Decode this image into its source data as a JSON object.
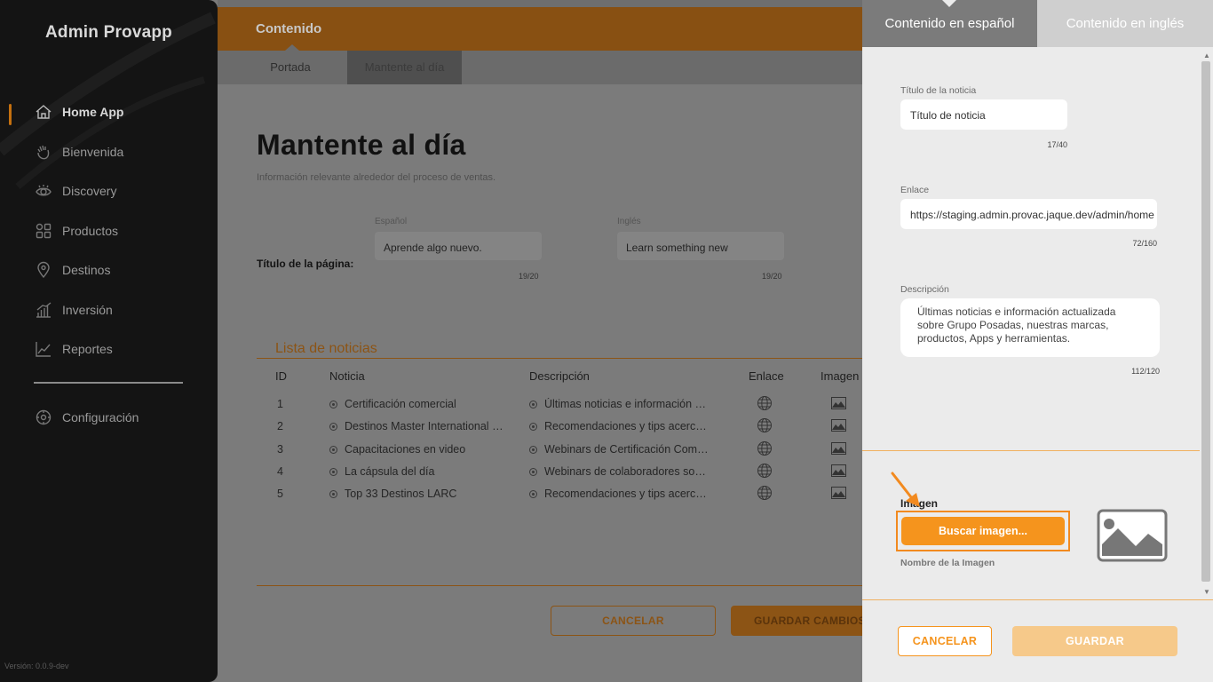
{
  "sidebar": {
    "brand": "Admin Provapp",
    "items": [
      {
        "label": "Home App",
        "icon": "home-icon",
        "active": true
      },
      {
        "label": "Bienvenida",
        "icon": "wave-hand-icon"
      },
      {
        "label": "Discovery",
        "icon": "eye-icon"
      },
      {
        "label": "Productos",
        "icon": "grid-icon"
      },
      {
        "label": "Destinos",
        "icon": "location-pin-icon"
      },
      {
        "label": "Inversión",
        "icon": "bar-chart-icon"
      },
      {
        "label": "Reportes",
        "icon": "line-chart-icon"
      }
    ],
    "settings": {
      "label": "Configuración",
      "icon": "gear-icon"
    },
    "version": "Versión: 0.0.9-dev"
  },
  "main": {
    "header_title": "Contenido",
    "tabs": [
      "Portada",
      "Mantente al día"
    ],
    "page_title": "Mantente al día",
    "page_desc": "Información relevante alrededor del proceso de ventas.",
    "field_label": "Título de la página:",
    "es_label": "Español",
    "es_value": "Aprende algo nuevo.",
    "es_count": "19/20",
    "en_label": "Inglés",
    "en_value": "Learn something new",
    "en_count": "19/20",
    "list_title": "Lista de noticias",
    "columns": [
      "ID",
      "Noticia",
      "Descripción",
      "Enlace",
      "Imagen"
    ],
    "rows": [
      {
        "id": "1",
        "noticia": "Certificación comercial",
        "descripcion": "Últimas noticias e información actualizada"
      },
      {
        "id": "2",
        "noticia": "Destinos Master International Certification",
        "descripcion": "Recomendaciones y tips acerca de destinos"
      },
      {
        "id": "3",
        "noticia": "Capacitaciones en video",
        "descripcion": "Webinars de Certificación Comercial"
      },
      {
        "id": "4",
        "noticia": "La cápsula del día",
        "descripcion": "Webinars de colaboradores sobre temas"
      },
      {
        "id": "5",
        "noticia": "Top 33 Destinos LARC",
        "descripcion": "Recomendaciones y tips acerca de destinos"
      }
    ],
    "cancel_label": "CANCELAR",
    "save_label": "GUARDAR CAMBIOS"
  },
  "panel": {
    "tab_es": "Contenido en español",
    "tab_en": "Contenido en inglés",
    "title_label": "Título de la noticia",
    "title_value": "Título de noticia",
    "title_count": "17/40",
    "link_label": "Enlace",
    "link_value": "https://staging.admin.provac.jaque.dev/admin/home",
    "link_count": "72/160",
    "desc_label": "Descripción",
    "desc_value": "Últimas noticias e información actualizada sobre Grupo Posadas, nuestras marcas, productos, Apps y herramientas.",
    "desc_count": "112/120",
    "image_label": "Imagen",
    "search_image_label": "Buscar imagen...",
    "image_name_label": "Nombre de la Imagen",
    "cancel_label": "CANCELAR",
    "save_label": "GUARDAR"
  },
  "colors": {
    "accent": "#f5941d",
    "sidebar_bg": "#141414",
    "panel_bg": "#ebebeb"
  }
}
